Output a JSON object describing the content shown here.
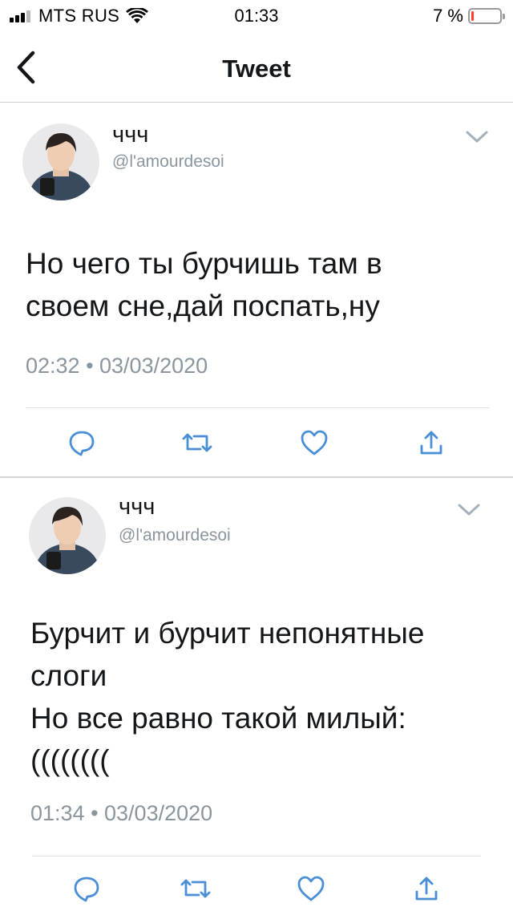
{
  "status_bar": {
    "carrier": "MTS RUS",
    "time": "01:33",
    "battery_percent": "7 %",
    "battery_level": 0.07,
    "signal_bars_active": 3,
    "signal_bars_total": 4,
    "battery_color": "#ff3b30"
  },
  "nav": {
    "back_icon": "chevron-left-icon",
    "title": "Tweet"
  },
  "tweets": [
    {
      "display_name": "ччч",
      "handle": "@l'amourdesoi",
      "text": "Но чего ты бурчишь там в\nсвоем сне,дай поспать,ну",
      "timestamp": "02:32 • 03/03/2020",
      "actions": [
        "reply-icon",
        "retweet-icon",
        "like-icon",
        "share-icon"
      ]
    },
    {
      "display_name": "ччч",
      "handle": "@l'amourdesoi",
      "text": "Бурчит и бурчит непонятные\nслоги\nНо все равно такой милый:\n((((((((",
      "timestamp": "01:34 • 03/03/2020",
      "actions": [
        "reply-icon",
        "retweet-icon",
        "like-icon",
        "share-icon"
      ]
    }
  ],
  "colors": {
    "text_primary": "#14171a",
    "text_secondary": "#8a959e",
    "icon_accent": "#4a8fd6",
    "divider": "#dfe2e5"
  }
}
